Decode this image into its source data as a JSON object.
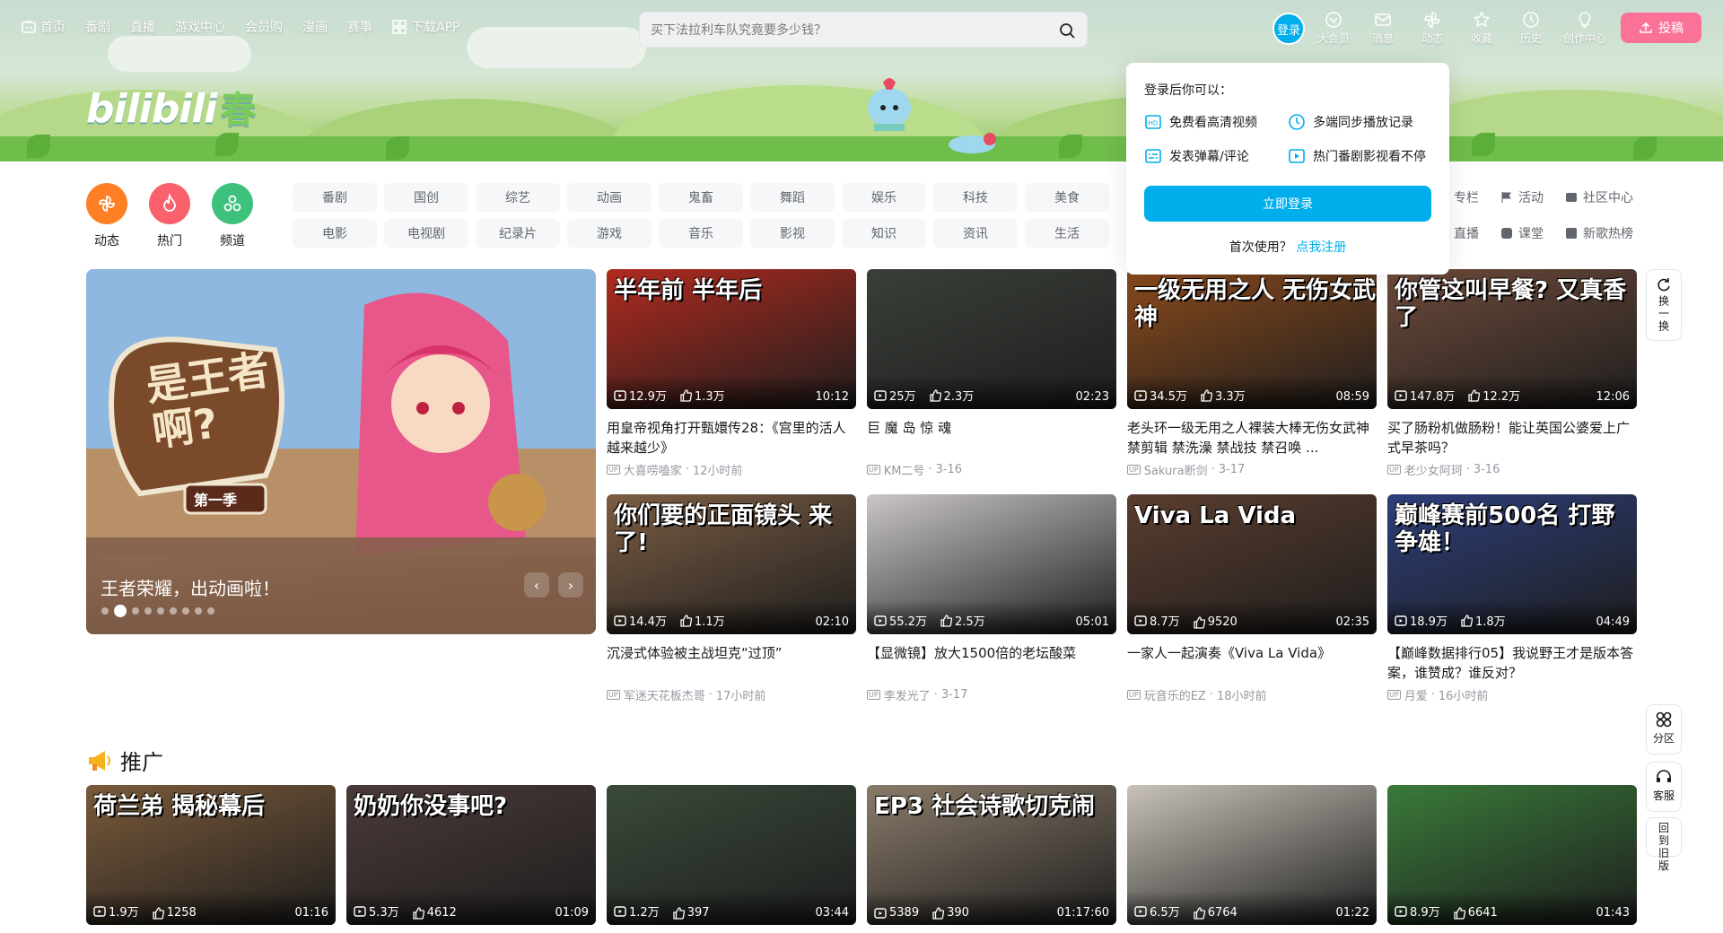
{
  "nav": {
    "home": "首页",
    "items": [
      "番剧",
      "直播",
      "游戏中心",
      "会员购",
      "漫画",
      "赛事"
    ],
    "app": "下载APP"
  },
  "search": {
    "placeholder": "买下法拉利车队究竟要多少钱？"
  },
  "user": {
    "login": "登录",
    "items": [
      "大会员",
      "消息",
      "动态",
      "收藏",
      "历史",
      "创作中心"
    ],
    "upload": "投稿"
  },
  "banner": {
    "logo_text": "bilibili",
    "logo_extra": "春"
  },
  "channels": {
    "icons": [
      {
        "label": "动态",
        "icon": "dynamic-icon",
        "color": "#ff7f24"
      },
      {
        "label": "热门",
        "icon": "fire-icon",
        "color": "#f9626d"
      },
      {
        "label": "频道",
        "icon": "channel-icon",
        "color": "#3ec17c"
      }
    ],
    "grid": [
      "番剧",
      "国创",
      "综艺",
      "动画",
      "鬼畜",
      "舞蹈",
      "娱乐",
      "科技",
      "美食",
      "电影",
      "电视剧",
      "纪录片",
      "游戏",
      "音乐",
      "影视",
      "知识",
      "资讯",
      "生活"
    ],
    "right": [
      {
        "label": "专栏",
        "icon": "column-icon"
      },
      {
        "label": "活动",
        "icon": "flag-icon"
      },
      {
        "label": "社区中心",
        "icon": "community-icon"
      },
      {
        "label": "直播",
        "icon": "live-icon"
      },
      {
        "label": "课堂",
        "icon": "class-icon"
      },
      {
        "label": "新歌热榜",
        "icon": "music-chart-icon"
      }
    ]
  },
  "carousel": {
    "title": "王者荣耀，出动画啦！",
    "art_text": "是王者啊?",
    "badge": "第一季",
    "active_dot": 1,
    "dot_count": 9
  },
  "videos": [
    {
      "title": "用皇帝视角打开甄嬛传28：《宫里的活人越来越少》",
      "up": "大喜唠嗑家",
      "time": "12小时前",
      "views": "12.9万",
      "likes": "1.3万",
      "duration": "10:12",
      "caption": "半年前 半年后",
      "bg": "#b02a1f"
    },
    {
      "title": "巨 魔 岛 惊 魂",
      "up": "KM二号",
      "time": "3-16",
      "views": "25万",
      "likes": "2.3万",
      "duration": "02:23",
      "caption": "",
      "bg": "#3a3f38"
    },
    {
      "title": "老头环一级无用之人裸装大棒无伤女武神 禁剪辑 禁洗澡 禁战技 禁召唤 ...",
      "up": "Sakura断剑",
      "time": "3-17",
      "views": "34.5万",
      "likes": "3.3万",
      "duration": "08:59",
      "caption": "一级无用之人 无伤女武神",
      "bg": "#8a4a1c"
    },
    {
      "title": "买了肠粉机做肠粉！能让英国公婆爱上广式早茶吗？",
      "up": "老少女阿珂",
      "time": "3-16",
      "views": "147.8万",
      "likes": "12.2万",
      "duration": "12:06",
      "caption": "你管这叫早餐? 又真香了",
      "bg": "#6d4a3a"
    },
    {
      "title": "沉浸式体验被主战坦克“过顶”",
      "up": "军迷天花板杰哥",
      "time": "17小时前",
      "views": "14.4万",
      "likes": "1.1万",
      "duration": "02:10",
      "caption": "你们要的正面镜头 来了!",
      "bg": "#7b5d43"
    },
    {
      "title": "【显微镜】放大1500倍的老坛酸菜",
      "up": "李发光了",
      "time": "3-17",
      "views": "55.2万",
      "likes": "2.5万",
      "duration": "05:01",
      "caption": "",
      "bg": "#c9c5c8"
    },
    {
      "title": "一家人一起演奏《Viva La Vida》",
      "up": "玩音乐的EZ",
      "time": "18小时前",
      "views": "8.7万",
      "likes": "9520",
      "duration": "02:35",
      "caption": "Viva La Vida",
      "bg": "#5a3d2e"
    },
    {
      "title": "【巅峰数据排行05】我说野王才是版本答案，谁赞成？谁反对？",
      "up": "月爱",
      "time": "16小时前",
      "views": "18.9万",
      "likes": "1.8万",
      "duration": "04:49",
      "caption": "巅峰赛前500名 打野争雄！",
      "bg": "#2d3e7a"
    }
  ],
  "section": {
    "title": "推广"
  },
  "promos": [
    {
      "views": "1.9万",
      "likes": "1258",
      "duration": "01:16",
      "caption": "荷兰弟 揭秘幕后",
      "bg": "#7a5a3a"
    },
    {
      "views": "5.3万",
      "likes": "4612",
      "duration": "01:09",
      "caption": "奶奶你没事吧?",
      "bg": "#4a3a38"
    },
    {
      "views": "1.2万",
      "likes": "397",
      "duration": "03:44",
      "caption": "",
      "bg": "#3a4a3a"
    },
    {
      "views": "5389",
      "likes": "390",
      "duration": "01:17:60",
      "caption": "EP3 社会诗歌切克闹",
      "bg": "#8a7b6a"
    },
    {
      "views": "6.5万",
      "likes": "6764",
      "duration": "01:22",
      "caption": "",
      "bg": "#c8c2b8"
    },
    {
      "views": "8.9万",
      "likes": "6641",
      "duration": "01:43",
      "caption": "",
      "bg": "#3a7a3a"
    }
  ],
  "popup": {
    "heading": "登录后你可以：",
    "features": [
      "免费看高清视频",
      "多端同步播放记录",
      "发表弹幕/评论",
      "热门番剧影视看不停"
    ],
    "button": "立即登录",
    "register_prefix": "首次使用？",
    "register_link": "点我注册"
  },
  "side": {
    "refresh": "换一换",
    "partition": "分区",
    "service": "客服",
    "back": "回到旧版"
  },
  "colors": {
    "accent": "#00aeec",
    "pink": "#fb7299"
  }
}
